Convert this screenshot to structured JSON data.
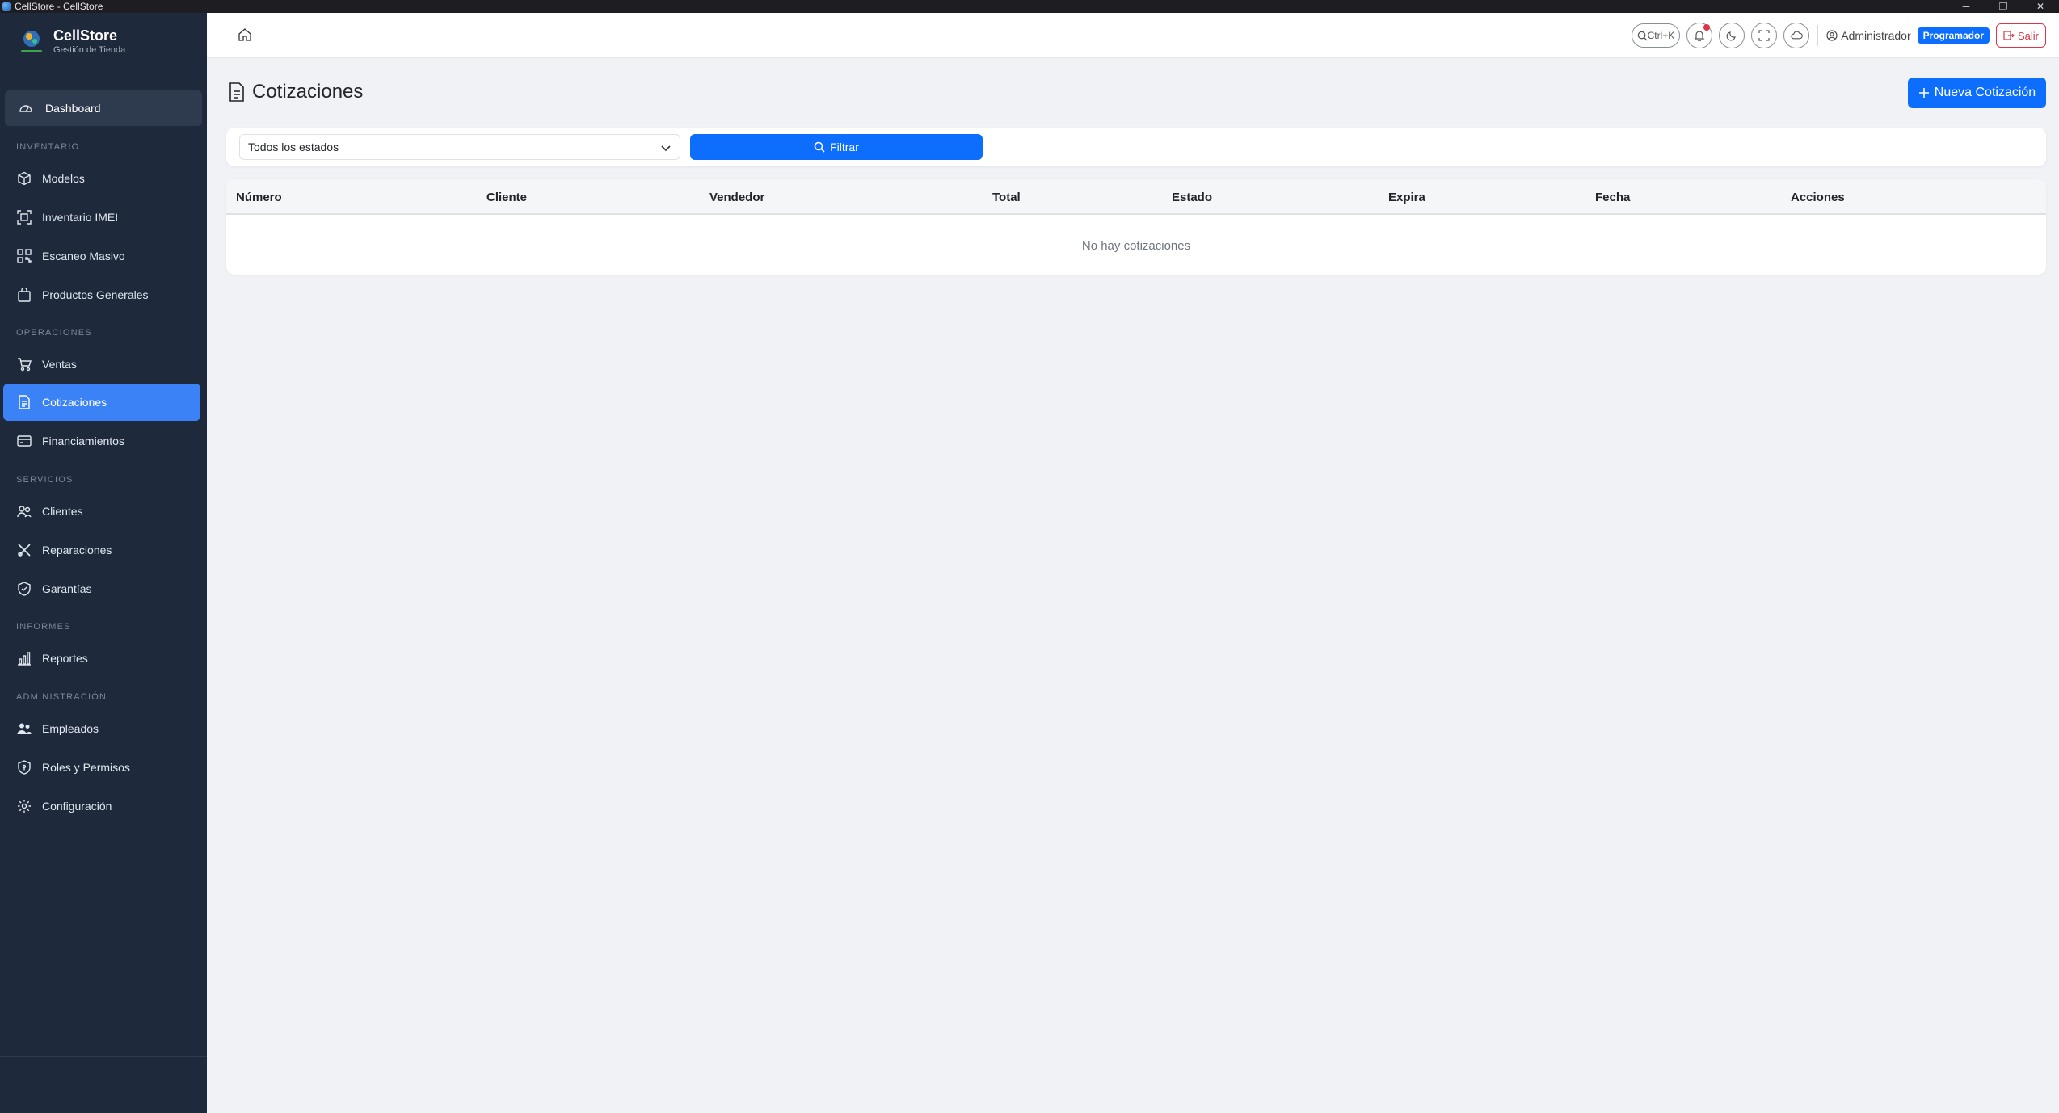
{
  "window": {
    "title": "CellStore - CellStore",
    "minimize": "─",
    "maximize": "❐",
    "close": "✕"
  },
  "brand": {
    "name": "CellStore",
    "tagline": "Gestión de Tienda"
  },
  "sidebar": {
    "dashboard": "Dashboard",
    "sections": {
      "inventario": "INVENTARIO",
      "operaciones": "OPERACIONES",
      "servicios": "SERVICIOS",
      "informes": "INFORMES",
      "administracion": "ADMINISTRACIÓN"
    },
    "items": {
      "modelos": "Modelos",
      "inventario_imei": "Inventario IMEI",
      "escaneo_masivo": "Escaneo Masivo",
      "productos_generales": "Productos Generales",
      "ventas": "Ventas",
      "cotizaciones": "Cotizaciones",
      "financiamientos": "Financiamientos",
      "clientes": "Clientes",
      "reparaciones": "Reparaciones",
      "garantias": "Garantías",
      "reportes": "Reportes",
      "empleados": "Empleados",
      "roles_permisos": "Roles y Permisos",
      "configuracion": "Configuración"
    },
    "active_item": "cotizaciones"
  },
  "topbar": {
    "search_shortcut": "Ctrl+K",
    "user_name": "Administrador",
    "role_badge": "Programador",
    "logout_label": "Salir"
  },
  "page": {
    "title": "Cotizaciones",
    "new_button": "Nueva Cotización"
  },
  "filters": {
    "status_select": "Todos los estados",
    "filter_button": "Filtrar"
  },
  "table": {
    "columns": [
      "Número",
      "Cliente",
      "Vendedor",
      "Total",
      "Estado",
      "Expira",
      "Fecha",
      "Acciones"
    ],
    "rows": [],
    "empty_message": "No hay cotizaciones"
  },
  "colors": {
    "sidebar_bg": "#1e293b",
    "active_item_bg": "#3b82f6",
    "primary": "#0d6efd",
    "danger": "#dc3545",
    "page_bg": "#f0f2f6"
  }
}
